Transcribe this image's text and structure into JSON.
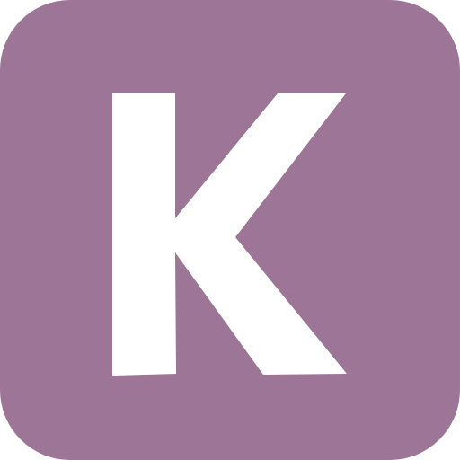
{
  "app_icon": {
    "icon": "app-logo-k-icon",
    "letter": "K",
    "background_color": "#9c7597",
    "glyph_color": "#ffffff"
  }
}
